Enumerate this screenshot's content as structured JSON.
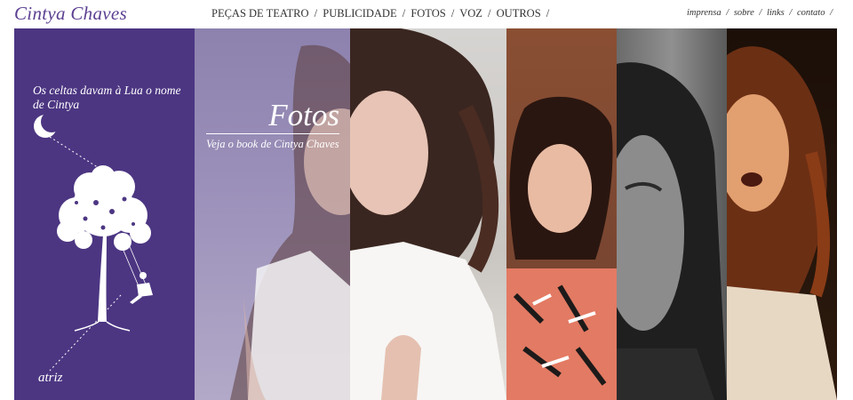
{
  "brand": {
    "name": "Cintya Chaves"
  },
  "nav": {
    "items": [
      "PEÇAS DE TEATRO",
      "PUBLICIDADE",
      "FOTOS",
      "VOZ",
      "OUTROS"
    ],
    "separator": "/"
  },
  "subnav": {
    "items": [
      "imprensa",
      "sobre",
      "links",
      "contato"
    ],
    "separator": "/"
  },
  "left_panel": {
    "quote": "Os celtas davam à Lua o nome de Cintya",
    "footer": "atriz"
  },
  "feature": {
    "title": "Fotos",
    "subtitle": "Veja o book de Cintya Chaves"
  },
  "colors": {
    "brand_purple": "#5b3f91",
    "panel_purple": "#4c3682",
    "text": "#333333"
  },
  "icons": {
    "moon": "crescent-moon-icon",
    "tree": "tree-swing-illustration"
  }
}
